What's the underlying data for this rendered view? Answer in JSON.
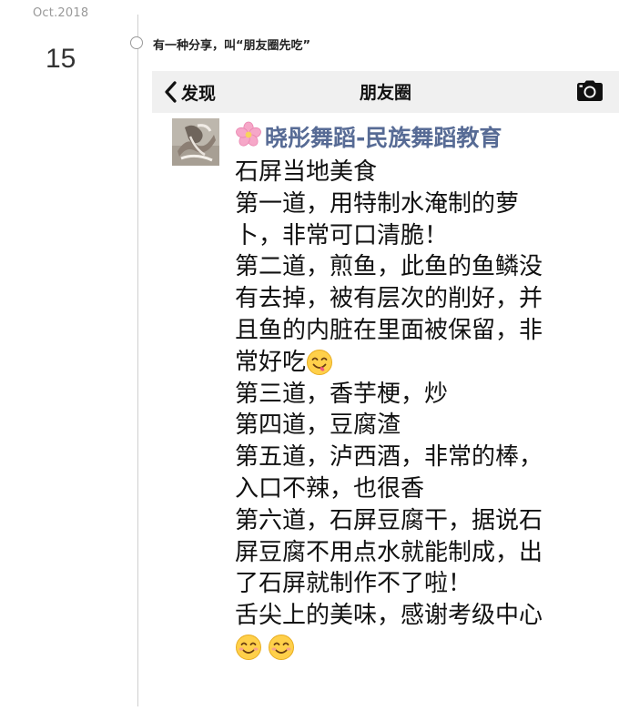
{
  "timeline": {
    "month": "Oct.2018",
    "day": "15",
    "post_title": "有一种分享，叫“朋友圈先吃”"
  },
  "screenshot": {
    "nav": {
      "back_label": "发现",
      "title": "朋友圈",
      "icons": [
        "chevron-left-icon",
        "camera-icon"
      ]
    },
    "author": {
      "flower_icon": "cherry-blossom-icon",
      "name": "晓彤舞蹈-民族舞蹈教育"
    },
    "lines": [
      "石屏当地美食",
      "第一道，用特制水淹制的萝",
      "卜，非常可口清脆！",
      "第二道，煎鱼，此鱼的鱼鳞没",
      "有去掉，被有层次的削好，并",
      "且鱼的内脏在里面被保留，非",
      "常好吃",
      "第三道，香芋梗，炒",
      "第四道，豆腐渣",
      "第五道，泸西酒，非常的棒，",
      "入口不辣，也很香",
      "第六道，石屏豆腐干，据说石",
      "屏豆腐不用点水就能制成，出",
      "了石屏就制作不了啦！",
      "舌尖上的美味，感谢考级中心"
    ],
    "emoji_names": [
      "yum-face-emoji",
      "smiling-face-emoji",
      "smiling-face-emoji"
    ],
    "colors": {
      "author_name": "#576b95",
      "nav_background": "#f0f0f0",
      "timeline": "#cfcfcf"
    }
  }
}
